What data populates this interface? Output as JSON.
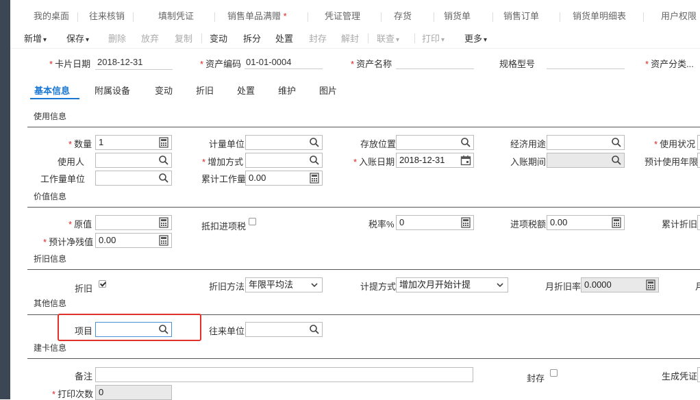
{
  "tabs": [
    "我的桌面",
    "往来核销",
    "填制凭证",
    "销售单品满赠",
    "凭证管理",
    "存货",
    "销货单",
    "销售订单",
    "销货单明细表",
    "用户权限"
  ],
  "tab_dirty_mark": "*",
  "toolbar": {
    "new": "新增",
    "save": "保存",
    "delete": "删除",
    "abandon": "放弃",
    "copy": "复制",
    "change": "变动",
    "split": "拆分",
    "dispose": "处置",
    "seal": "封存",
    "unseal": "解封",
    "query": "联查",
    "print": "打印",
    "more": "更多"
  },
  "required_mark": "*",
  "header": {
    "card_date_label": "卡片日期",
    "card_date_value": "2018-12-31",
    "asset_code_label": "资产编码",
    "asset_code_value": "01-01-0004",
    "asset_name_label": "资产名称",
    "asset_name_value": "",
    "spec_label": "规格型号",
    "spec_value": "",
    "category_label": "资产分类..."
  },
  "subtabs": [
    "基本信息",
    "附属设备",
    "变动",
    "折旧",
    "处置",
    "维护",
    "图片"
  ],
  "sections": {
    "usage": "使用信息",
    "value": "价值信息",
    "depreciation": "折旧信息",
    "other": "其他信息",
    "build": "建卡信息"
  },
  "usage": {
    "quantity_label": "数量",
    "quantity_value": "1",
    "unit_label": "计量单位",
    "location_label": "存放位置",
    "econ_use_label": "经济用途",
    "use_status_label": "使用状况",
    "user_label": "使用人",
    "add_method_label": "增加方式",
    "entry_date_label": "入账日期",
    "entry_date_value": "2018-12-31",
    "entry_period_label": "入账期间",
    "est_life_label": "预计使用年限",
    "workload_unit_label": "工作量单位",
    "cum_workload_label": "累计工作量",
    "cum_workload_value": "0.00"
  },
  "value": {
    "original_label": "原值",
    "original_value": "",
    "deduct_tax_label": "抵扣进项税",
    "tax_rate_label": "税率%",
    "tax_rate_value": "0",
    "input_tax_label": "进项税额",
    "input_tax_value": "0.00",
    "cum_dep_label": "累计折旧",
    "residual_label": "预计净残值",
    "residual_value": "0.00"
  },
  "depreciation": {
    "dep_label": "折旧",
    "dep_checked": true,
    "method_label": "折旧方法",
    "method_value": "年限平均法",
    "accrual_label": "计提方式",
    "accrual_value": "增加次月开始计提",
    "monthly_rate_label": "月折旧率",
    "monthly_rate_value": "0.0000",
    "cut_label": "月"
  },
  "other": {
    "project_label": "项目",
    "project_value": "",
    "partner_label": "往来单位",
    "partner_value": ""
  },
  "build": {
    "remark_label": "备注",
    "remark_value": "",
    "seal_label": "封存",
    "gen_voucher_label": "生成凭证",
    "print_count_label": "打印次数",
    "print_count_value": "0"
  }
}
